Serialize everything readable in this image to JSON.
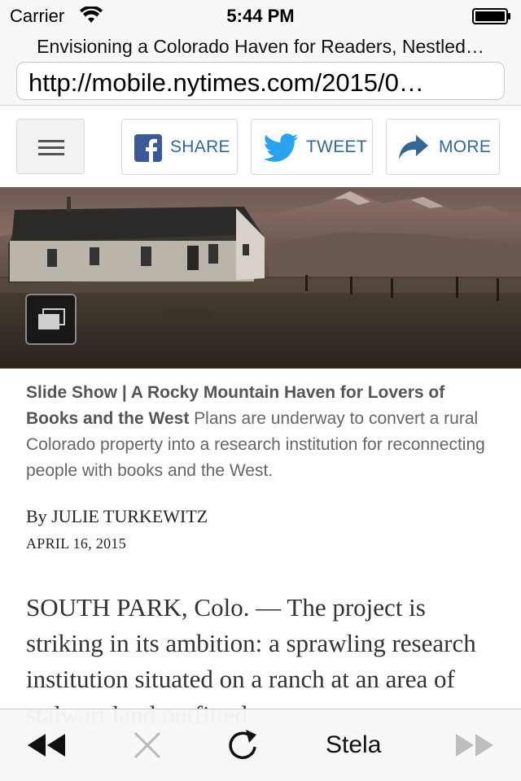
{
  "status_bar": {
    "carrier": "Carrier",
    "time": "5:44 PM"
  },
  "browser": {
    "page_title": "Envisioning a Colorado Haven for Readers, Nestled…",
    "url": "http://mobile.nytimes.com/2015/0…"
  },
  "share_row": {
    "facebook_label": "SHARE",
    "twitter_label": "TWEET",
    "more_label": "MORE",
    "accent_color": "#326891"
  },
  "caption": {
    "bold_text": "Slide Show | A Rocky Mountain Haven for Lovers of Books and the West",
    "text": "Plans are underway to convert a rural Colorado property into a research institution for reconnecting people with books and the West."
  },
  "byline": "By JULIE TURKEWITZ",
  "dateline": "APRIL 16, 2015",
  "article": {
    "lead": "SOUTH PARK, Colo. — The project is striking in its ambition: a sprawling research institution situated on a ranch at an area of stalwart land outfitted"
  },
  "toolbar": {
    "stela_label": "Stela",
    "icons": [
      "rewind-icon",
      "close-icon",
      "reload-icon",
      "fast-forward-icon"
    ]
  }
}
